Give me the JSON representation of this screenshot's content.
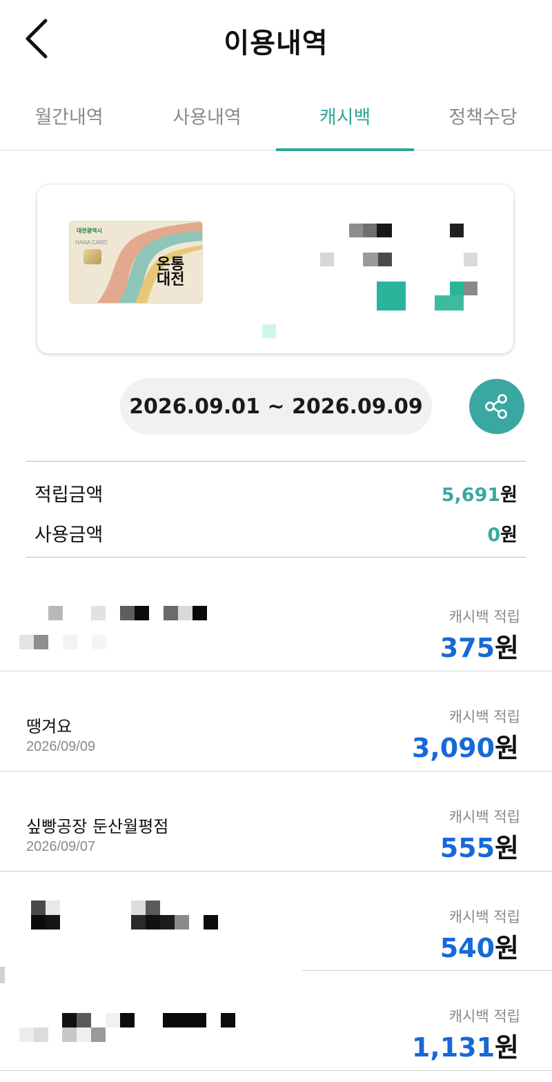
{
  "header": {
    "title": "이용내역"
  },
  "tabs": [
    {
      "label": "월간내역",
      "active": false
    },
    {
      "label": "사용내역",
      "active": false
    },
    {
      "label": "캐시백",
      "active": true
    },
    {
      "label": "정책수당",
      "active": false
    }
  ],
  "card": {
    "city": "대전광역시",
    "bank": "HANA CARD",
    "brand": "온통대전"
  },
  "date_range": "2026.09.01 ~ 2026.09.09",
  "summary": {
    "earned_label": "적립금액",
    "earned_value": "5,691",
    "earned_unit": "원",
    "used_label": "사용금액",
    "used_value": "0",
    "used_unit": "원"
  },
  "colors": {
    "accent": "#3aa8a0",
    "amount_blue": "#1669d8"
  },
  "icons": [
    "back-arrow-icon",
    "share-icon"
  ],
  "transactions": [
    {
      "name": "",
      "date": "",
      "type": "캐시백 적립",
      "amount": "375",
      "unit": "원"
    },
    {
      "name": "땡겨요",
      "date": "2026/09/09",
      "type": "캐시백 적립",
      "amount": "3,090",
      "unit": "원"
    },
    {
      "name": "싶빵공장 둔산월평점",
      "date": "2026/09/07",
      "type": "캐시백 적립",
      "amount": "555",
      "unit": "원"
    },
    {
      "name": "",
      "date": "",
      "type": "캐시백 적립",
      "amount": "540",
      "unit": "원"
    },
    {
      "name": "",
      "date": "",
      "type": "캐시백 적립",
      "amount": "1,131",
      "unit": "원"
    }
  ]
}
